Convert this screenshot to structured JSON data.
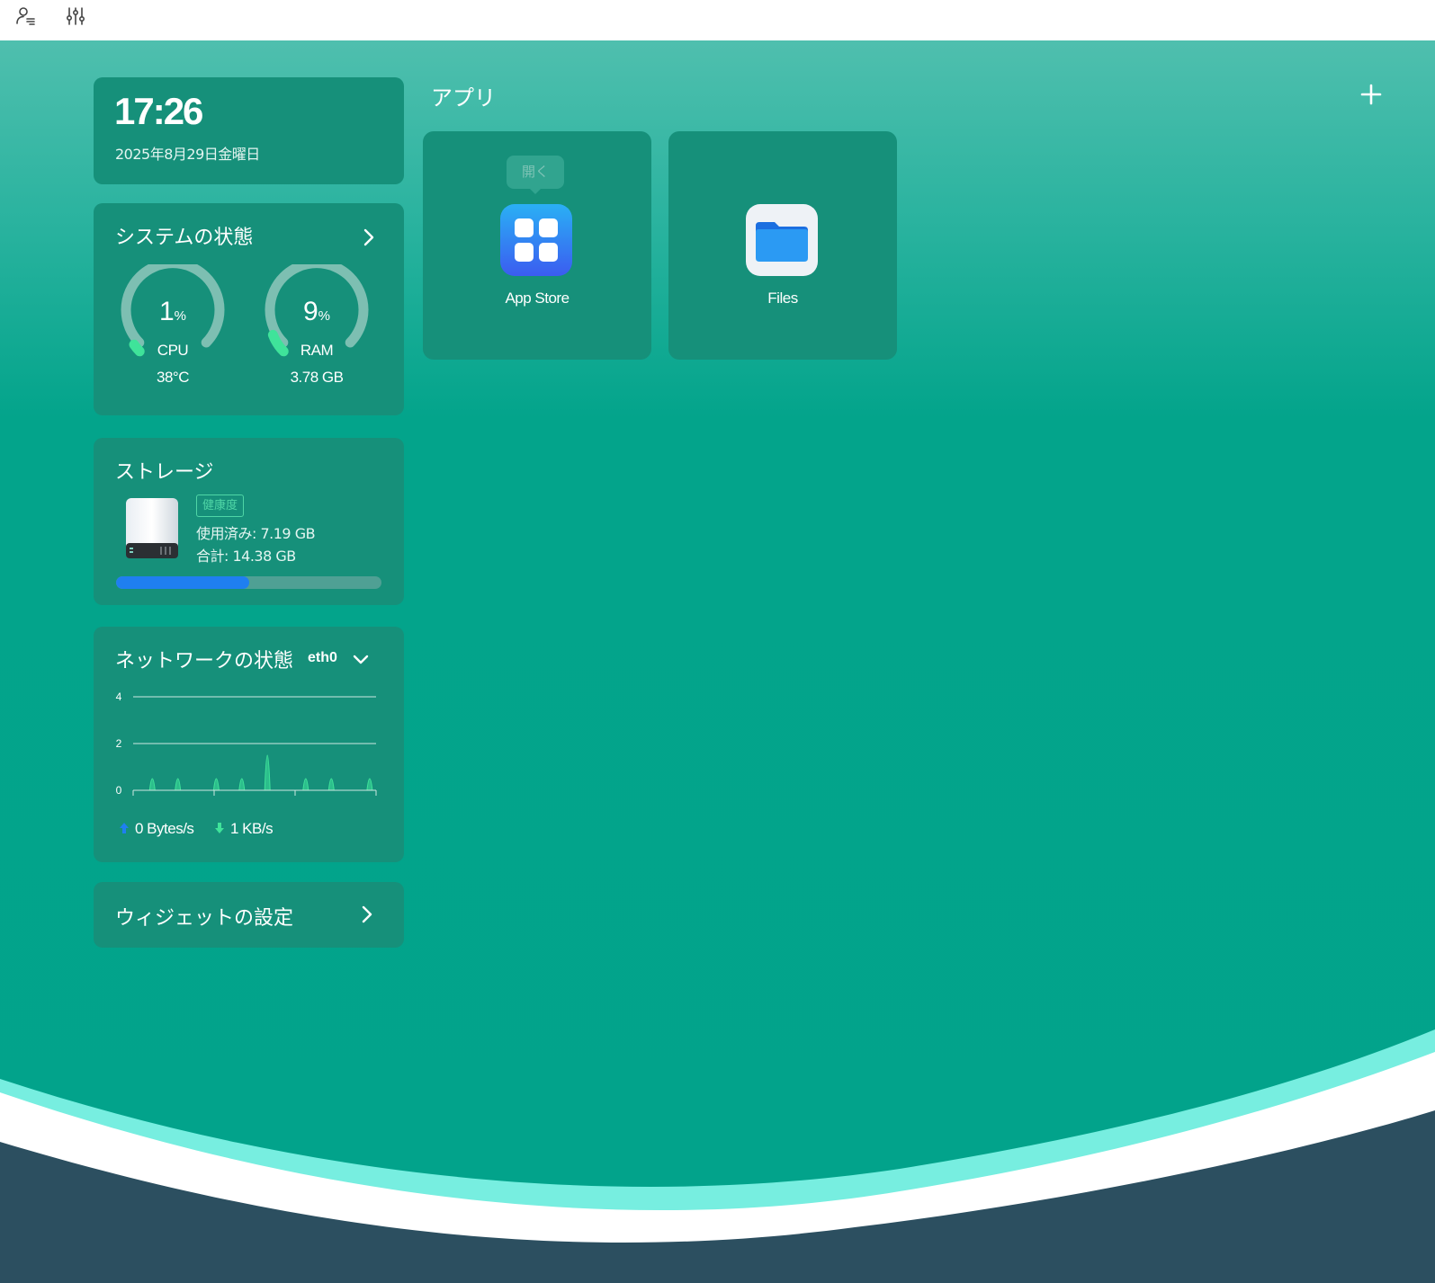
{
  "topbar": {
    "icons": [
      "user-menu-icon",
      "settings-sliders-icon"
    ]
  },
  "clock": {
    "time": "17:26",
    "date": "2025年8月29日金曜日"
  },
  "system": {
    "title": "システムの状態",
    "cpu": {
      "value": "1",
      "unit": "%",
      "label": "CPU",
      "sub": "38°C",
      "percent": 1
    },
    "ram": {
      "value": "9",
      "unit": "%",
      "label": "RAM",
      "sub": "3.78 GB",
      "percent": 9
    }
  },
  "storage": {
    "title": "ストレージ",
    "health_label": "健康度",
    "used": "使用済み: 7.19 GB",
    "total": "合計: 14.38 GB",
    "used_fraction": 0.5
  },
  "network": {
    "title": "ネットワークの状態",
    "interface": "eth0",
    "upload": "0 Bytes/s",
    "download": "1 KB/s",
    "chart_data": {
      "type": "area",
      "y_ticks": [
        "4",
        "2",
        "0"
      ],
      "ylim": [
        0,
        4
      ],
      "series": [
        {
          "values": [
            0,
            1,
            0,
            1,
            0,
            0,
            1,
            0,
            1,
            0,
            3,
            0,
            0,
            1,
            0,
            1,
            0,
            0,
            1
          ]
        }
      ]
    }
  },
  "widget_settings": {
    "label": "ウィジェットの設定"
  },
  "apps": {
    "title": "アプリ",
    "items": [
      {
        "name": "App Store",
        "tooltip": "開く",
        "icon": "app-store-icon"
      },
      {
        "name": "Files",
        "icon": "folder-icon"
      }
    ]
  },
  "colors": {
    "accent": "#02a38b",
    "card": "#16907a",
    "gauge_active": "#3fe39a",
    "storage_fill": "#1f7ff0",
    "dock_dark": "#2c4f60"
  }
}
